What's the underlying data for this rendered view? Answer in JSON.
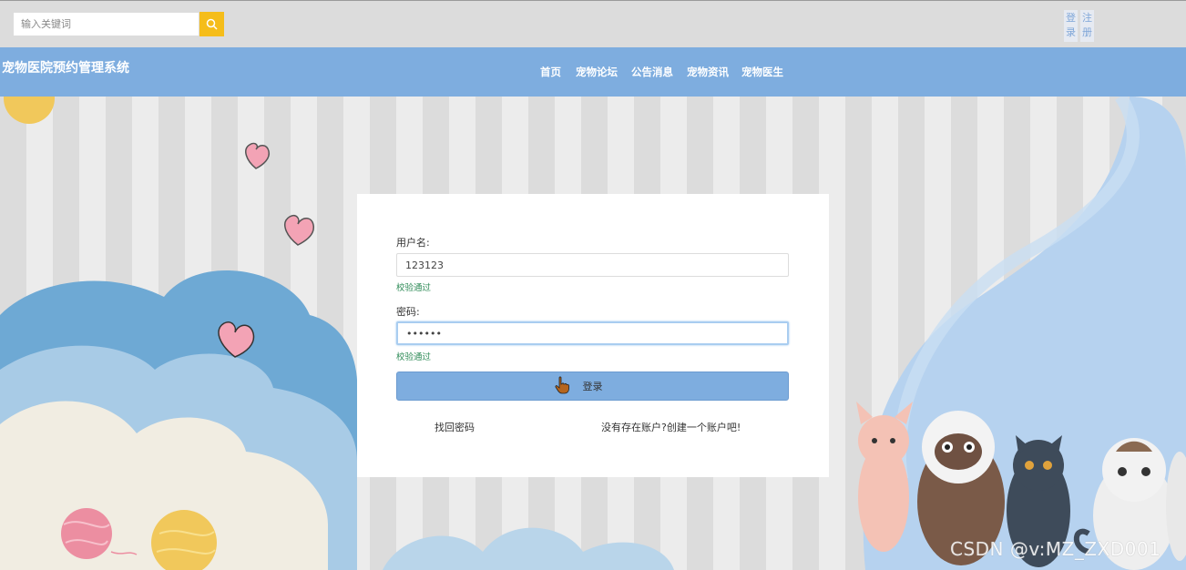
{
  "search": {
    "placeholder": "输入关键词",
    "icon": "search-icon"
  },
  "auth": {
    "login": "登录",
    "register": "注册"
  },
  "site": {
    "title": "宠物医院预约管理系统"
  },
  "nav": {
    "items": [
      "首页",
      "宠物论坛",
      "公告消息",
      "宠物资讯",
      "宠物医生"
    ]
  },
  "form": {
    "username_label": "用户名:",
    "username_value": "123123",
    "username_hint": "校验通过",
    "password_label": "密码:",
    "password_value": "••••••",
    "password_hint": "校验通过",
    "submit_label": "登录",
    "forgot_label": "找回密码",
    "register_label": "没有存在账户?创建一个账户吧!"
  },
  "watermark": "CSDN @v:MZ_ZXD001",
  "colors": {
    "nav_bg": "#7eaddf",
    "search_btn": "#f5bd1a",
    "hint": "#2e8b57"
  }
}
